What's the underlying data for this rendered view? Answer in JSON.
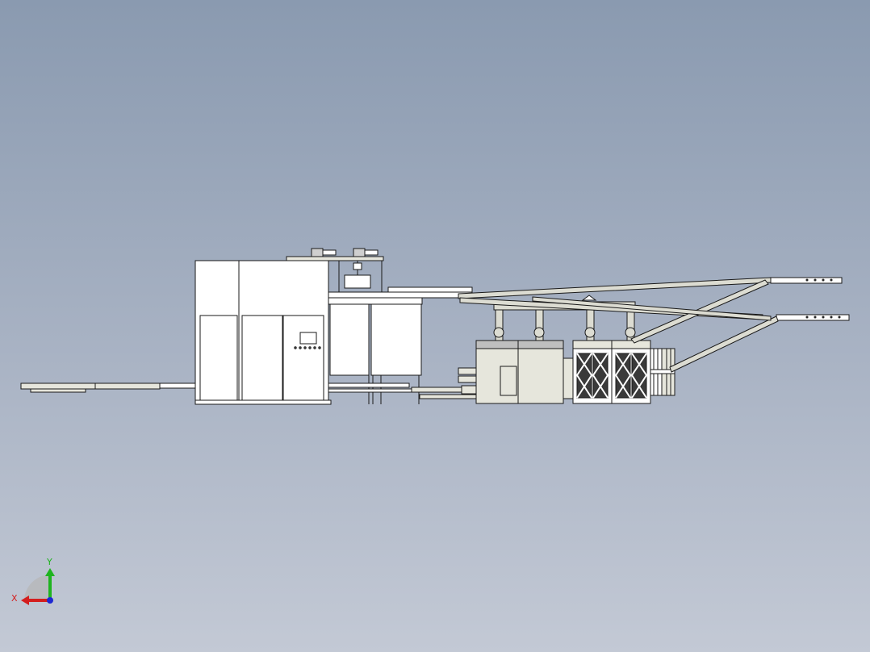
{
  "viewport": {
    "background_top": "#8a9ab0",
    "background_bottom": "#c3c9d5"
  },
  "model": {
    "line_color": "#1a1a1a",
    "panel_fill": "#ffffff",
    "accent_fill": "#e6e6dc",
    "duct_fill": "#dcdcd2"
  },
  "triad": {
    "x_label": "X",
    "y_label": "Y",
    "x_color": "#d41e1e",
    "y_color": "#1fb41f",
    "z_color": "#1e28d2"
  }
}
